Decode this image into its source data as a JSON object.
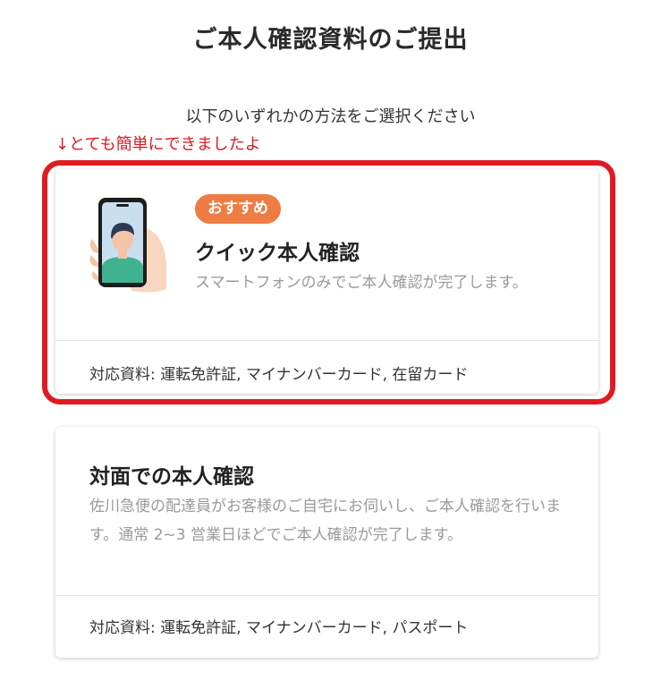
{
  "page": {
    "title": "ご本人確認資料のご提出",
    "subtitle": "以下のいずれかの方法をご選択ください",
    "annotation": "↓とても簡単にできましたよ"
  },
  "quick_card": {
    "badge": "おすすめ",
    "title": "クイック本人確認",
    "description": "スマートフォンのみでご本人確認が完了します。",
    "documents": "対応資料: 運転免許証, マイナンバーカード, 在留カード",
    "illustration_icon": "smartphone-selfie-icon"
  },
  "face_card": {
    "title": "対面での本人確認",
    "description": "佐川急便の配達員がお客様のご自宅にお伺いし、ご本人確認を行います。通常 2~3 営業日ほどでご本人確認が完了します。",
    "documents": "対応資料: 運転免許証, マイナンバーカード, パスポート"
  },
  "colors": {
    "badge": "#ee7d44",
    "highlight": "#e01a22",
    "muted_text": "#9a9a9a"
  }
}
